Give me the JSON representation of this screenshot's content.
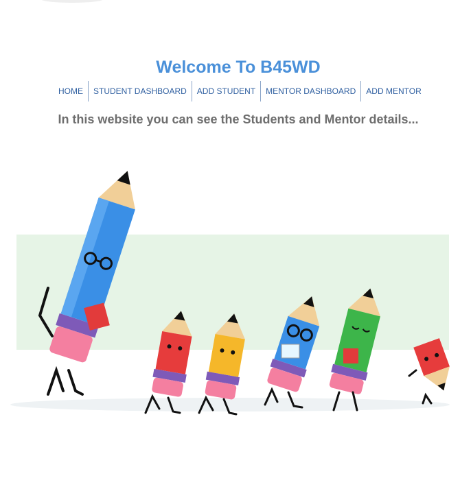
{
  "header": {
    "title": "Welcome To B45WD"
  },
  "nav": {
    "items": [
      {
        "label": "HOME"
      },
      {
        "label": "STUDENT DASHBOARD"
      },
      {
        "label": "ADD STUDENT"
      },
      {
        "label": "MENTOR DASHBOARD"
      },
      {
        "label": "ADD MENTOR"
      }
    ]
  },
  "main": {
    "tagline": "In this website you can see the Students and Mentor details..."
  },
  "colors": {
    "title": "#4a90d9",
    "nav_link": "#2f5fa0",
    "tagline": "#6e6e6e",
    "backdrop": "#e6f4e6"
  },
  "illustration": {
    "subject": "marching-pencils",
    "figures": [
      "blue-pencil-teacher",
      "red-pencil",
      "yellow-pencil",
      "blue-pencil-glasses",
      "green-pencil",
      "red-pencil-small"
    ]
  }
}
